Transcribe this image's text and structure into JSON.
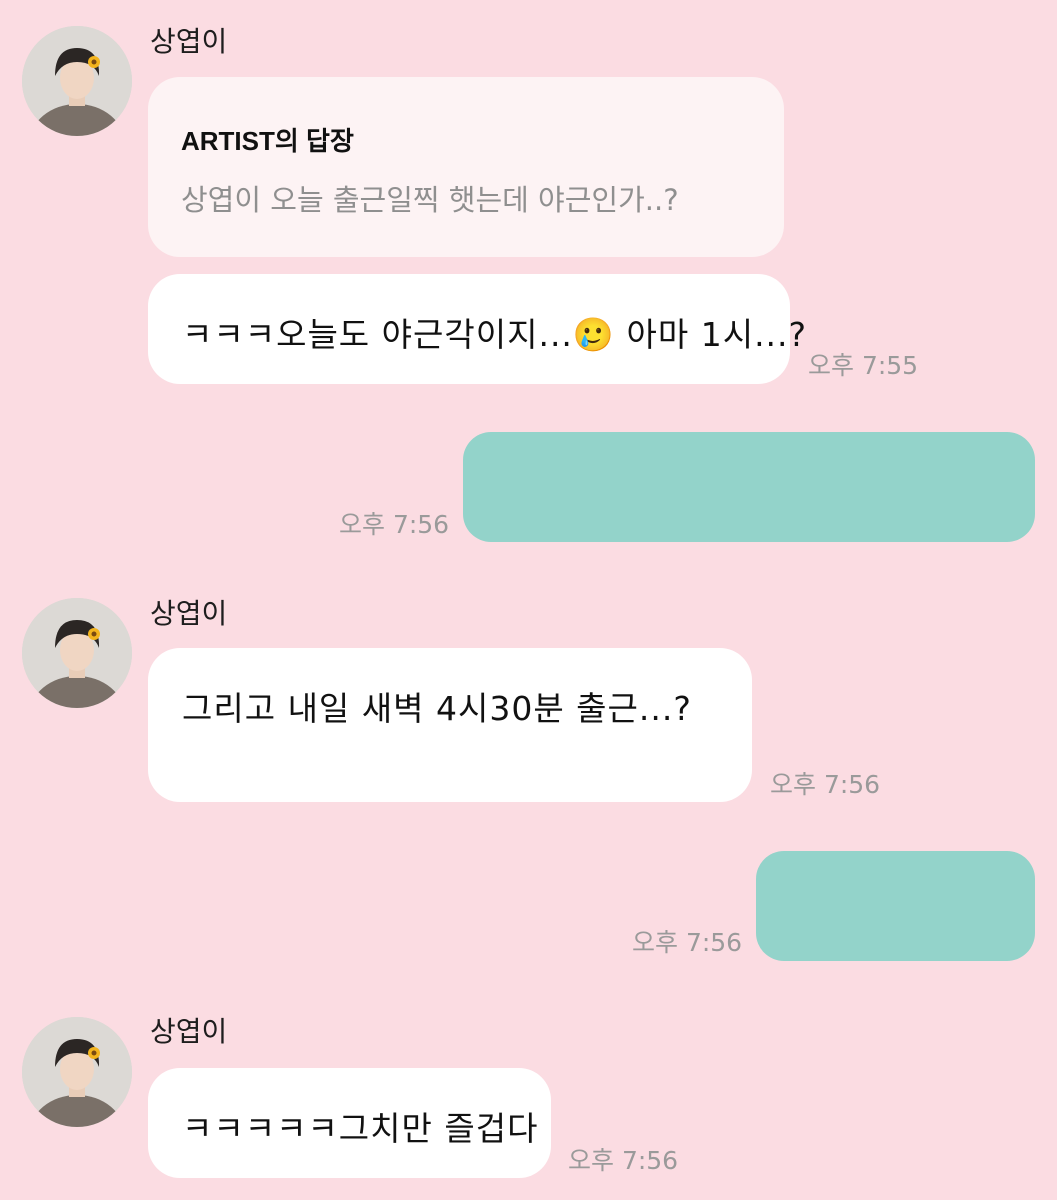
{
  "sender_name": "상엽이",
  "messages": {
    "m1_reply": {
      "title": "ARTIST의 답장",
      "quote": "상엽이 오늘 출근일찍 햇는데 야근인가..?"
    },
    "m2": {
      "text": "ㅋㅋㅋ오늘도 야근각이지...🥲 아마 1시...?",
      "time": "오후 7:55"
    },
    "m3_mine": {
      "time": "오후 7:56"
    },
    "m4": {
      "text": "그리고 내일 새벽 4시30분 출근...?",
      "time": "오후 7:56"
    },
    "m5_mine": {
      "time": "오후 7:56"
    },
    "m6": {
      "text": "ㅋㅋㅋㅋㅋ그치만 즐겁다",
      "time": "오후 7:56"
    }
  },
  "colors": {
    "background": "#fbdce2",
    "incoming_bubble": "#ffffff",
    "reply_bubble": "#fdf3f4",
    "outgoing_bubble": "#93d3ca",
    "timestamp": "#9a9a9a"
  },
  "icons": {
    "avatar": "profile-photo-avatar"
  }
}
